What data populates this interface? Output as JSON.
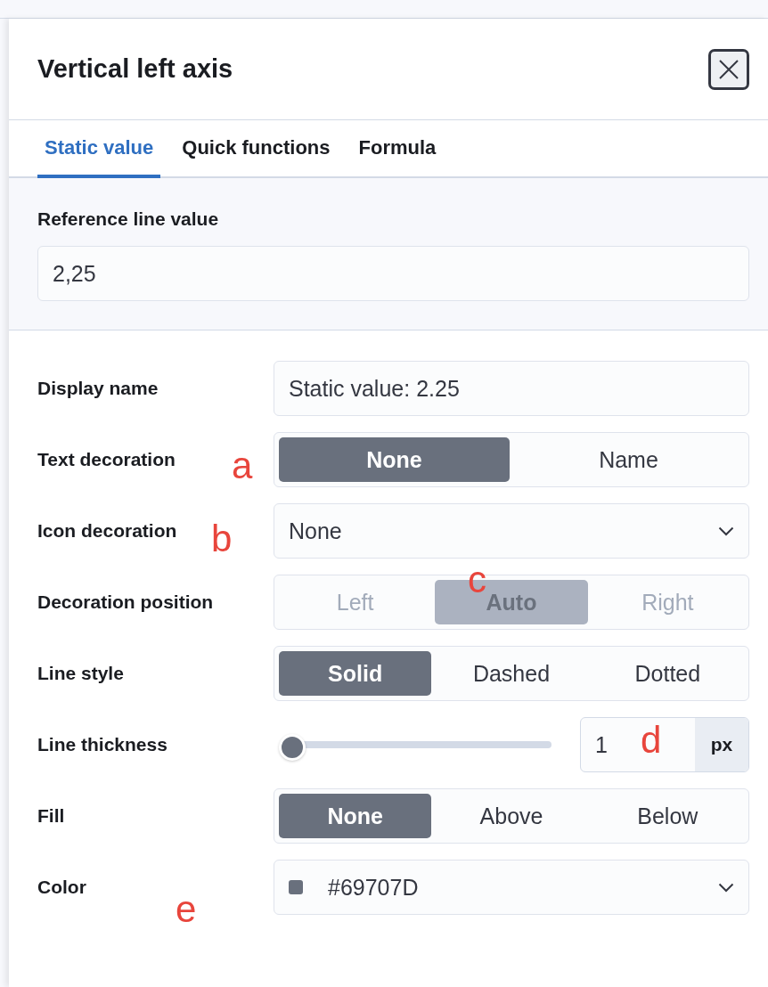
{
  "panel": {
    "title": "Vertical left axis"
  },
  "tabs": [
    {
      "label": "Static value",
      "selected": true
    },
    {
      "label": "Quick functions",
      "selected": false
    },
    {
      "label": "Formula",
      "selected": false
    }
  ],
  "reference": {
    "label": "Reference line value",
    "value": "2,25"
  },
  "rows": [
    {
      "kind": "text",
      "label": "Display name",
      "value": "Static value: 2.25"
    },
    {
      "kind": "group",
      "label": "Text decoration",
      "disabled": false,
      "options": [
        {
          "label": "None",
          "selected": true
        },
        {
          "label": "Name",
          "selected": false
        }
      ]
    },
    {
      "kind": "select",
      "label": "Icon decoration",
      "value": "None"
    },
    {
      "kind": "group",
      "label": "Decoration position",
      "disabled": true,
      "options": [
        {
          "label": "Left",
          "selected": false
        },
        {
          "label": "Auto",
          "selected": true
        },
        {
          "label": "Right",
          "selected": false
        }
      ]
    },
    {
      "kind": "group",
      "label": "Line style",
      "disabled": false,
      "options": [
        {
          "label": "Solid",
          "selected": true
        },
        {
          "label": "Dashed",
          "selected": false
        },
        {
          "label": "Dotted",
          "selected": false
        }
      ]
    },
    {
      "kind": "slider",
      "label": "Line thickness",
      "level": 0,
      "value": "1",
      "unit": "px"
    },
    {
      "kind": "group",
      "label": "Fill",
      "disabled": false,
      "options": [
        {
          "label": "None",
          "selected": true
        },
        {
          "label": "Above",
          "selected": false
        },
        {
          "label": "Below",
          "selected": false
        }
      ]
    },
    {
      "kind": "color",
      "label": "Color",
      "value": "#69707D",
      "color": "#69707d"
    }
  ],
  "annotations": [
    "a",
    "b",
    "c",
    "d",
    "e"
  ]
}
